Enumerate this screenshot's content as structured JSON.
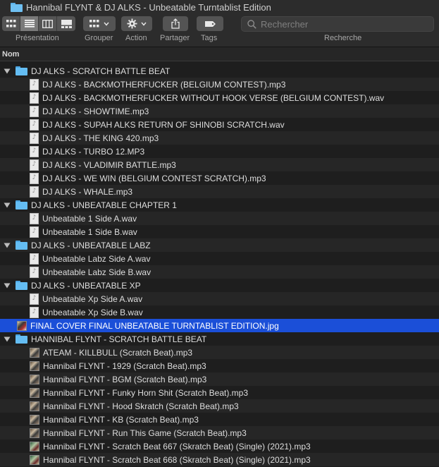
{
  "window": {
    "title": "Hannibal FLYNT & DJ ALKS - Unbeatable Turntablist Edition"
  },
  "toolbar": {
    "presentation_label": "Présentation",
    "group_label": "Grouper",
    "action_label": "Action",
    "share_label": "Partager",
    "tags_label": "Tags",
    "search_label": "Recherche",
    "search_placeholder": "Rechercher",
    "view_modes": [
      {
        "icon": "grid-view-icon",
        "active": false
      },
      {
        "icon": "list-view-icon",
        "active": true
      },
      {
        "icon": "columns-view-icon",
        "active": false
      },
      {
        "icon": "gallery-view-icon",
        "active": false
      }
    ]
  },
  "columns": {
    "name": "Nom"
  },
  "rows": [
    {
      "type": "folder",
      "name": "DJ ALKS - SCRATCH BATTLE BEAT"
    },
    {
      "type": "file",
      "name": "DJ ALKS - BACKMOTHERFUCKER (BELGIUM CONTEST).mp3"
    },
    {
      "type": "file",
      "name": "DJ ALKS - BACKMOTHERFUCKER WITHOUT HOOK VERSE (BELGIUM CONTEST).wav"
    },
    {
      "type": "file",
      "name": "DJ ALKS - SHOWTIME.mp3"
    },
    {
      "type": "file",
      "name": "DJ ALKS - SUPAH ALKS RETURN OF SHINOBI SCRATCH.wav"
    },
    {
      "type": "file",
      "name": "DJ ALKS - THE KING 420.mp3"
    },
    {
      "type": "file",
      "name": "DJ ALKS - TURBO 12.MP3"
    },
    {
      "type": "file",
      "name": "DJ ALKS - VLADIMIR BATTLE.mp3"
    },
    {
      "type": "file",
      "name": "DJ ALKS - WE WIN (BELGIUM CONTEST SCRATCH).mp3"
    },
    {
      "type": "file",
      "name": "DJ ALKS - WHALE.mp3"
    },
    {
      "type": "folder",
      "name": "DJ ALKS - UNBEATABLE CHAPTER 1"
    },
    {
      "type": "file",
      "name": "Unbeatable 1 Side A.wav"
    },
    {
      "type": "file",
      "name": "Unbeatable 1 Side B.wav"
    },
    {
      "type": "folder",
      "name": "DJ ALKS - UNBEATABLE LABZ"
    },
    {
      "type": "file",
      "name": "Unbeatable Labz Side A.wav"
    },
    {
      "type": "file",
      "name": "Unbeatable Labz Side B.wav"
    },
    {
      "type": "folder",
      "name": "DJ ALKS - UNBEATABLE XP"
    },
    {
      "type": "file",
      "name": "Unbeatable Xp Side A.wav"
    },
    {
      "type": "file",
      "name": "Unbeatable Xp Side B.wav"
    },
    {
      "type": "image",
      "name": "FINAL COVER FINAL UNBEATABLE TURNTABLIST EDITION.jpg",
      "selected": true
    },
    {
      "type": "folder",
      "name": "HANNIBAL FLYNT - SCRATCH BATTLE BEAT"
    },
    {
      "type": "art",
      "name": "ATEAM - KILLBULL (Scratch Beat).mp3"
    },
    {
      "type": "art",
      "name": "Hannibal FLYNT - 1929 (Scratch Beat).mp3"
    },
    {
      "type": "art",
      "name": "Hannibal FLYNT - BGM (Scratch Beat).mp3"
    },
    {
      "type": "art",
      "name": "Hannibal FLYNT - Funky Horn Shit (Scratch Beat).mp3"
    },
    {
      "type": "art",
      "name": "Hannibal FLYNT - Hood Skratch (Scratch Beat).mp3"
    },
    {
      "type": "art",
      "name": "Hannibal FLYNT - KB (Scratch Beat).mp3"
    },
    {
      "type": "art",
      "name": "Hannibal FLYNT - Run This Game (Scratch Beat).mp3"
    },
    {
      "type": "art2",
      "name": "Hannibal FLYNT - Scratch Beat 667 (Skratch Beat) (Single) (2021).mp3"
    },
    {
      "type": "art2",
      "name": "Hannibal FLYNT - Scratch Beat 668 (Skratch Beat) (Single) (2021).mp3"
    }
  ]
}
